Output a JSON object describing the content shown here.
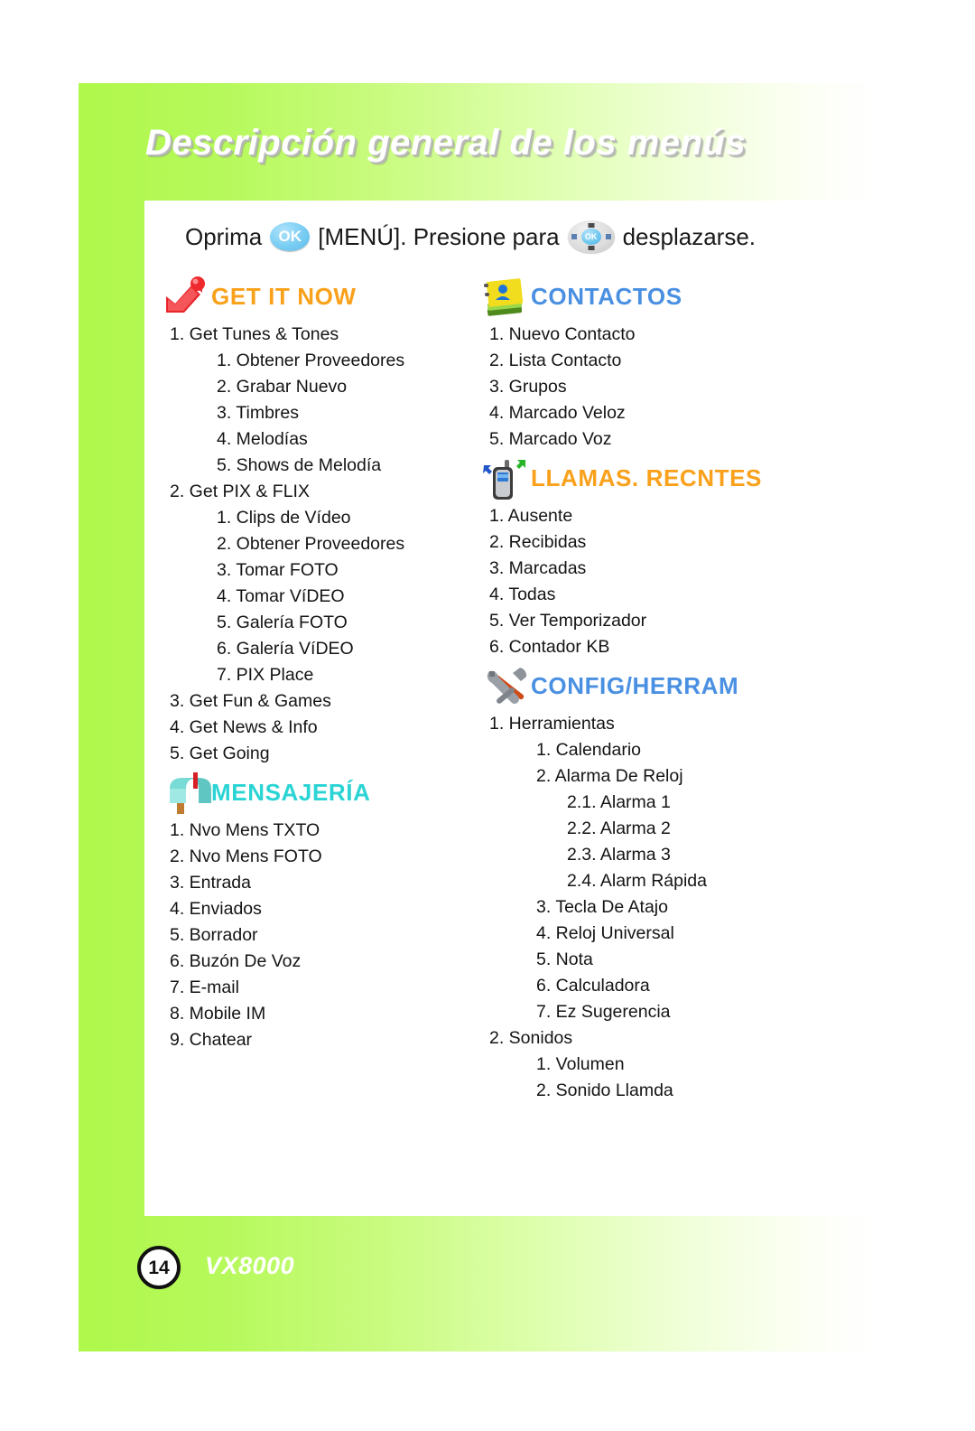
{
  "header": {
    "title": "Descripción general de los menús"
  },
  "instruction": {
    "before_ok": "Oprima",
    "ok_label": "OK",
    "middle": "[MENÚ]. Presione para",
    "navpad_label": "OK",
    "after": "desplazarse."
  },
  "colors": {
    "page_green": "#b0f84b",
    "get_it_now": "#F9A11B",
    "contactos": "#4A90E2",
    "llamas_recntes": "#F9A11B",
    "mensajeria": "#2BD4D4",
    "config_herram": "#4A90E2",
    "text": "#141414"
  },
  "sections": [
    {
      "id": "get-it-now",
      "title": "GET IT NOW",
      "icon": "red-arrow-pin-icon",
      "color": "#F9A11B",
      "column": "left",
      "items": [
        {
          "level": 1,
          "text": "1. Get Tunes & Tones"
        },
        {
          "level": 2,
          "text": "1. Obtener Proveedores"
        },
        {
          "level": 2,
          "text": "2. Grabar Nuevo"
        },
        {
          "level": 2,
          "text": "3. Timbres"
        },
        {
          "level": 2,
          "text": "4. Melodías"
        },
        {
          "level": 2,
          "text": "5. Shows de Melodía"
        },
        {
          "level": 1,
          "text": "2. Get PIX & FLIX"
        },
        {
          "level": 2,
          "text": "1. Clips de Vídeo"
        },
        {
          "level": 2,
          "text": "2. Obtener Proveedores"
        },
        {
          "level": 2,
          "text": "3. Tomar FOTO"
        },
        {
          "level": 2,
          "text": "4. Tomar VíDEO"
        },
        {
          "level": 2,
          "text": "5. Galería FOTO"
        },
        {
          "level": 2,
          "text": "6. Galería VíDEO"
        },
        {
          "level": 2,
          "text": "7. PIX Place"
        },
        {
          "level": 1,
          "text": "3. Get Fun & Games"
        },
        {
          "level": 1,
          "text": "4. Get News & Info"
        },
        {
          "level": 1,
          "text": "5. Get Going"
        }
      ]
    },
    {
      "id": "mensajeria",
      "title": "MENSAJERÍA",
      "icon": "mailbox-icon",
      "color": "#2BD4D4",
      "column": "left",
      "items": [
        {
          "level": 1,
          "text": "1. Nvo Mens TXTO"
        },
        {
          "level": 1,
          "text": "2. Nvo Mens FOTO"
        },
        {
          "level": 1,
          "text": "3. Entrada"
        },
        {
          "level": 1,
          "text": "4. Enviados"
        },
        {
          "level": 1,
          "text": "5. Borrador"
        },
        {
          "level": 1,
          "text": "6. Buzón De Voz"
        },
        {
          "level": 1,
          "text": "7. E-mail"
        },
        {
          "level": 1,
          "text": "8. Mobile IM"
        },
        {
          "level": 1,
          "text": "9. Chatear"
        }
      ]
    },
    {
      "id": "contactos",
      "title": "CONTACTOS",
      "icon": "address-book-icon",
      "color": "#4A90E2",
      "column": "right",
      "items": [
        {
          "level": 1,
          "text": "1. Nuevo Contacto"
        },
        {
          "level": 1,
          "text": "2. Lista Contacto"
        },
        {
          "level": 1,
          "text": "3. Grupos"
        },
        {
          "level": 1,
          "text": "4. Marcado Veloz"
        },
        {
          "level": 1,
          "text": "5. Marcado Voz"
        }
      ]
    },
    {
      "id": "llamas-recntes",
      "title": "LLAMAS. RECNTES",
      "icon": "mobile-phone-calls-icon",
      "color": "#F9A11B",
      "column": "right",
      "items": [
        {
          "level": 1,
          "text": "1. Ausente"
        },
        {
          "level": 1,
          "text": "2. Recibidas"
        },
        {
          "level": 1,
          "text": "3. Marcadas"
        },
        {
          "level": 1,
          "text": "4. Todas"
        },
        {
          "level": 1,
          "text": "5. Ver Temporizador"
        },
        {
          "level": 1,
          "text": "6. Contador KB"
        }
      ]
    },
    {
      "id": "config-herram",
      "title": "CONFIG/HERRAM",
      "icon": "wrench-hammer-icon",
      "color": "#4A90E2",
      "column": "right",
      "items": [
        {
          "level": 1,
          "text": "1. Herramientas"
        },
        {
          "level": 2,
          "text": "1. Calendario"
        },
        {
          "level": 2,
          "text": "2. Alarma De Reloj"
        },
        {
          "level": 3,
          "text": "2.1. Alarma 1"
        },
        {
          "level": 3,
          "text": "2.2. Alarma 2"
        },
        {
          "level": 3,
          "text": "2.3. Alarma 3"
        },
        {
          "level": 3,
          "text": "2.4. Alarm Rápida"
        },
        {
          "level": 2,
          "text": "3. Tecla De Atajo"
        },
        {
          "level": 2,
          "text": "4. Reloj Universal"
        },
        {
          "level": 2,
          "text": "5. Nota"
        },
        {
          "level": 2,
          "text": "6. Calculadora"
        },
        {
          "level": 2,
          "text": "7. Ez Sugerencia"
        },
        {
          "level": 1,
          "text": "2. Sonidos"
        },
        {
          "level": 2,
          "text": "1. Volumen"
        },
        {
          "level": 2,
          "text": "2. Sonido Llamda"
        }
      ]
    }
  ],
  "footer": {
    "page_number": "14",
    "model": "VX8000"
  }
}
